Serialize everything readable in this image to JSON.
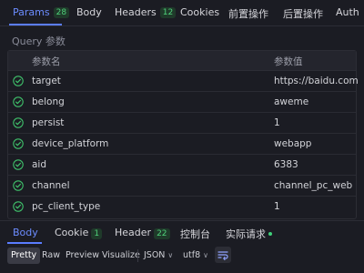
{
  "top_tabs": [
    {
      "label": "Params",
      "badge": "28"
    },
    {
      "label": "Body"
    },
    {
      "label": "Headers",
      "badge": "12"
    },
    {
      "label": "Cookies"
    },
    {
      "label": "前置操作"
    },
    {
      "label": "后置操作"
    },
    {
      "label": "Auth"
    }
  ],
  "query": {
    "section_label": "Query 参数",
    "headers": {
      "name": "参数名",
      "value": "参数值"
    },
    "rows": [
      {
        "name": "target",
        "value": "https://baidu.com"
      },
      {
        "name": "belong",
        "value": "aweme"
      },
      {
        "name": "persist",
        "value": "1"
      },
      {
        "name": "device_platform",
        "value": "webapp"
      },
      {
        "name": "aid",
        "value": "6383"
      },
      {
        "name": "channel",
        "value": "channel_pc_web"
      },
      {
        "name": "pc_client_type",
        "value": "1"
      }
    ]
  },
  "response_tabs": [
    {
      "label": "Body"
    },
    {
      "label": "Cookie",
      "badge": "1"
    },
    {
      "label": "Header",
      "badge": "22"
    },
    {
      "label": "控制台"
    },
    {
      "label": "实际请求"
    }
  ],
  "toolbar": {
    "views": [
      "Pretty",
      "Raw",
      "Preview",
      "Visualize"
    ],
    "format": "JSON",
    "encoding": "utf8"
  },
  "colors": {
    "accent": "#5b7dff",
    "check": "#3fbf6a",
    "badge": "#4fd07a"
  }
}
